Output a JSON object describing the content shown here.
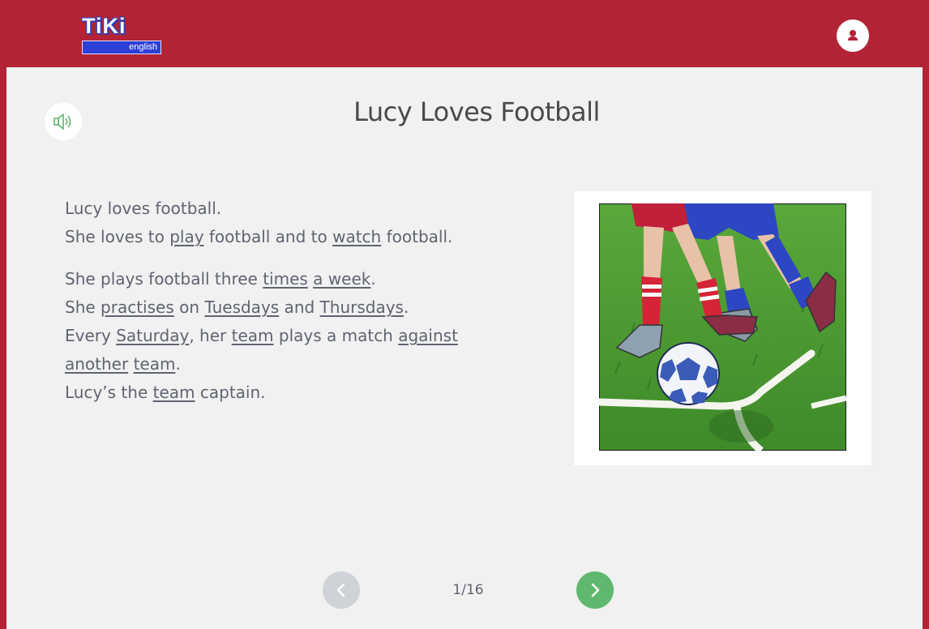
{
  "header": {
    "logo": {
      "main": "TiKi",
      "sub": "english"
    },
    "colors": {
      "brand": "#b12335",
      "logo_blue": "#2c3fd6"
    },
    "avatar_icon": "user-icon"
  },
  "lesson": {
    "audio_icon": "speaker-icon",
    "title": "Lucy Loves Football",
    "paragraphs": [
      [
        [
          {
            "t": "Lucy loves football."
          }
        ],
        [
          {
            "t": "She loves to "
          },
          {
            "t": "play",
            "u": true
          },
          {
            "t": " football and to "
          },
          {
            "t": "watch",
            "u": true
          },
          {
            "t": " football."
          }
        ]
      ],
      [
        [
          {
            "t": "She plays football three "
          },
          {
            "t": "times",
            "u": true
          },
          {
            "t": " "
          },
          {
            "t": "a week",
            "u": true
          },
          {
            "t": "."
          }
        ],
        [
          {
            "t": "She "
          },
          {
            "t": "practises",
            "u": true
          },
          {
            "t": " on "
          },
          {
            "t": "Tuesdays",
            "u": true
          },
          {
            "t": " and "
          },
          {
            "t": "Thursdays",
            "u": true
          },
          {
            "t": "."
          }
        ],
        [
          {
            "t": "Every "
          },
          {
            "t": "Saturday",
            "u": true
          },
          {
            "t": ", her "
          },
          {
            "t": "team",
            "u": true
          },
          {
            "t": " plays a match "
          },
          {
            "t": "against",
            "u": true
          }
        ],
        [
          {
            "t": "another",
            "u": true
          },
          {
            "t": " "
          },
          {
            "t": "team",
            "u": true
          },
          {
            "t": "."
          }
        ],
        [
          {
            "t": "Lucy’s the "
          },
          {
            "t": "team",
            "u": true
          },
          {
            "t": " captain."
          }
        ]
      ]
    ],
    "illustration_icon": "football-players-illustration"
  },
  "pager": {
    "prev_icon": "chevron-left-icon",
    "next_icon": "chevron-right-icon",
    "page_label": "1/16",
    "prev_enabled": false,
    "next_enabled": true,
    "colors": {
      "prev": "#cfd2d6",
      "next": "#5fb86d"
    }
  }
}
